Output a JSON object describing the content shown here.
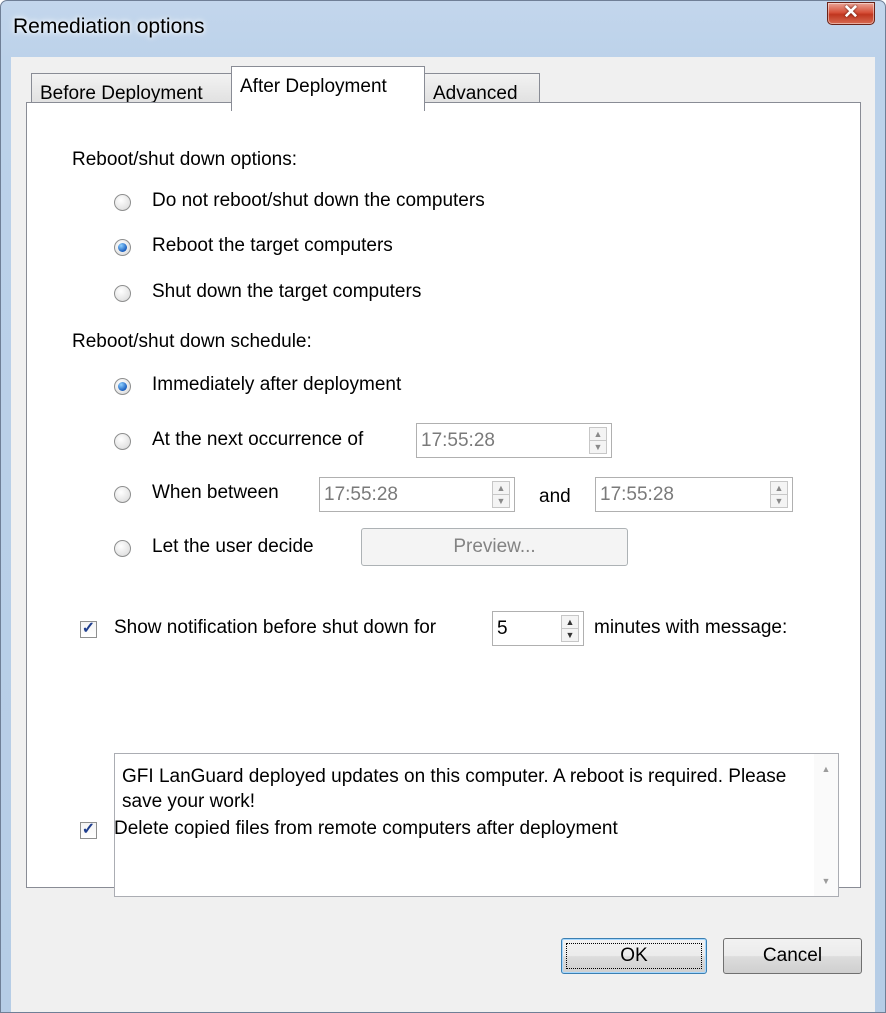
{
  "window": {
    "title": "Remediation options",
    "close_symbol": "✕"
  },
  "tabs": [
    {
      "label": "Before Deployment",
      "active": false
    },
    {
      "label": "After Deployment",
      "active": true
    },
    {
      "label": "Advanced",
      "active": false
    }
  ],
  "reboot_options": {
    "heading": "Reboot/shut down options:",
    "items": [
      {
        "label": "Do not reboot/shut down the computers",
        "selected": false
      },
      {
        "label": "Reboot the target computers",
        "selected": true
      },
      {
        "label": "Shut down the target computers",
        "selected": false
      }
    ]
  },
  "schedule": {
    "heading": "Reboot/shut down schedule:",
    "immediately": {
      "label": "Immediately after deployment",
      "selected": true
    },
    "next_occurrence": {
      "label": "At the next occurrence of",
      "selected": false,
      "time": "17:55:28"
    },
    "when_between": {
      "label": "When between",
      "selected": false,
      "from": "17:55:28",
      "and_label": "and",
      "to": "17:55:28"
    },
    "user_decide": {
      "label": "Let the user decide",
      "selected": false,
      "preview_label": "Preview..."
    }
  },
  "notification": {
    "checked": true,
    "label": "Show notification before shut down for",
    "minutes": "5",
    "suffix": "minutes with message:",
    "message": "GFI LanGuard deployed updates on this computer. A reboot is required. Please save your work!"
  },
  "delete_files": {
    "checked": true,
    "label": "Delete copied files from remote computers after deployment"
  },
  "buttons": {
    "ok": "OK",
    "cancel": "Cancel"
  }
}
